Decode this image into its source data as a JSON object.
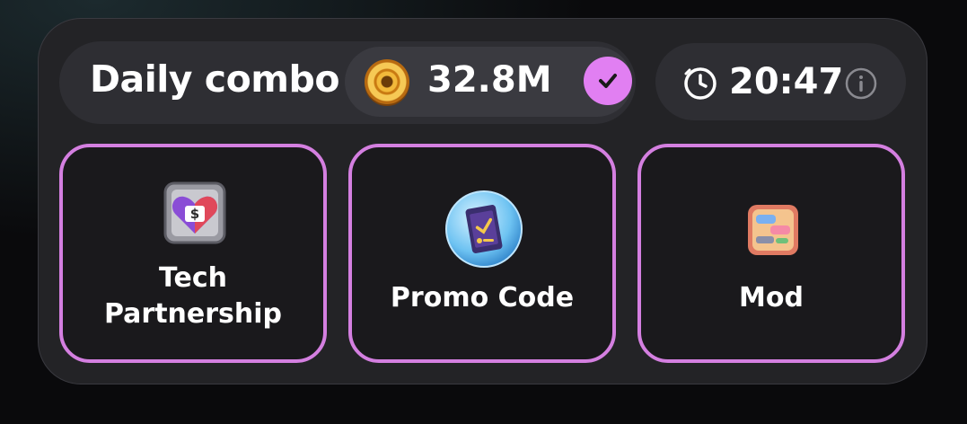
{
  "daily_combo": {
    "title": "Daily combo",
    "reward_amount": "32.8M",
    "reward_icon": "coin-icon",
    "completed_icon": "check-icon"
  },
  "timer": {
    "time": "20:47",
    "clock_icon": "clock-icon",
    "info_icon": "info-icon"
  },
  "cards": [
    {
      "label_line1": "Tech",
      "label_line2": "Partnership",
      "icon": "dollar-heart-icon"
    },
    {
      "label": "Promo Code",
      "icon": "ticket-icon"
    },
    {
      "label": "Mod",
      "icon": "chat-card-icon"
    }
  ],
  "colors": {
    "accent": "#e17ff2",
    "card_border": "#d47fe0",
    "panel": "#232326"
  }
}
